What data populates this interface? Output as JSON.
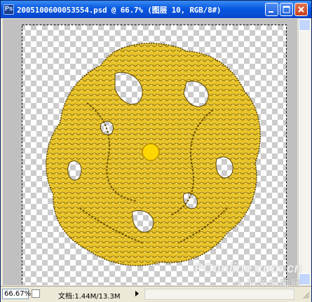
{
  "window": {
    "title": "2005100600053554.psd @ 66.7% (图层 10, RGB/8#)",
    "app_icon": "photoshop-icon",
    "buttons": [
      "minimize-icon",
      "maximize-icon",
      "close-icon"
    ]
  },
  "canvas": {
    "icon": "dragon-emblem-icon",
    "accent_color": "#e8c42a"
  },
  "status": {
    "zoom": "66.67%",
    "doc_info": "文档:1.44M/13.3M"
  },
  "watermark": {
    "brand": "PConline.com.cn",
    "tagline": "太平洋电脑网"
  }
}
